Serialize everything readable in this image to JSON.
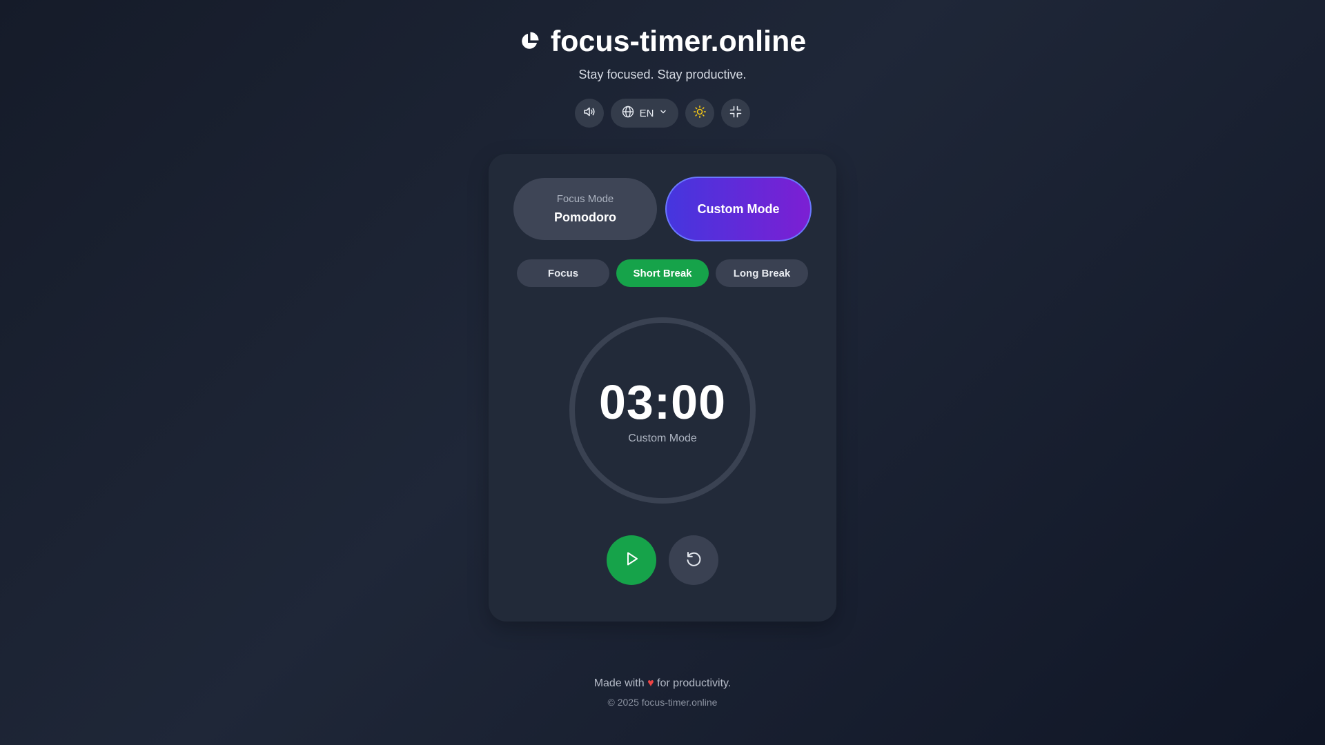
{
  "header": {
    "logo_icon": "pie-timer-icon",
    "title": "focus-timer.online",
    "subtitle": "Stay focused. Stay productive."
  },
  "toolbar": {
    "sound_icon": "speaker-icon",
    "language_icon": "globe-icon",
    "language_value": "EN",
    "theme_icon": "sun-icon",
    "fullscreen_icon": "collapse-icon"
  },
  "modes": {
    "pomodoro_small": "Focus Mode",
    "pomodoro_label": "Pomodoro",
    "custom_label": "Custom Mode"
  },
  "phases": {
    "focus": "Focus",
    "short_break": "Short Break",
    "long_break": "Long Break",
    "active": "short_break"
  },
  "timer": {
    "time": "03:00",
    "label": "Custom Mode"
  },
  "footer": {
    "made_with": "Made with",
    "heart": "♥",
    "for_productivity": "for productivity.",
    "copyright": "© 2025 focus-timer.online"
  },
  "colors": {
    "accent_green": "#16a34a",
    "accent_purple_start": "#4536de",
    "accent_purple_end": "#7c1fd3",
    "sun_yellow": "#facc15",
    "heart_red": "#ef4444"
  }
}
